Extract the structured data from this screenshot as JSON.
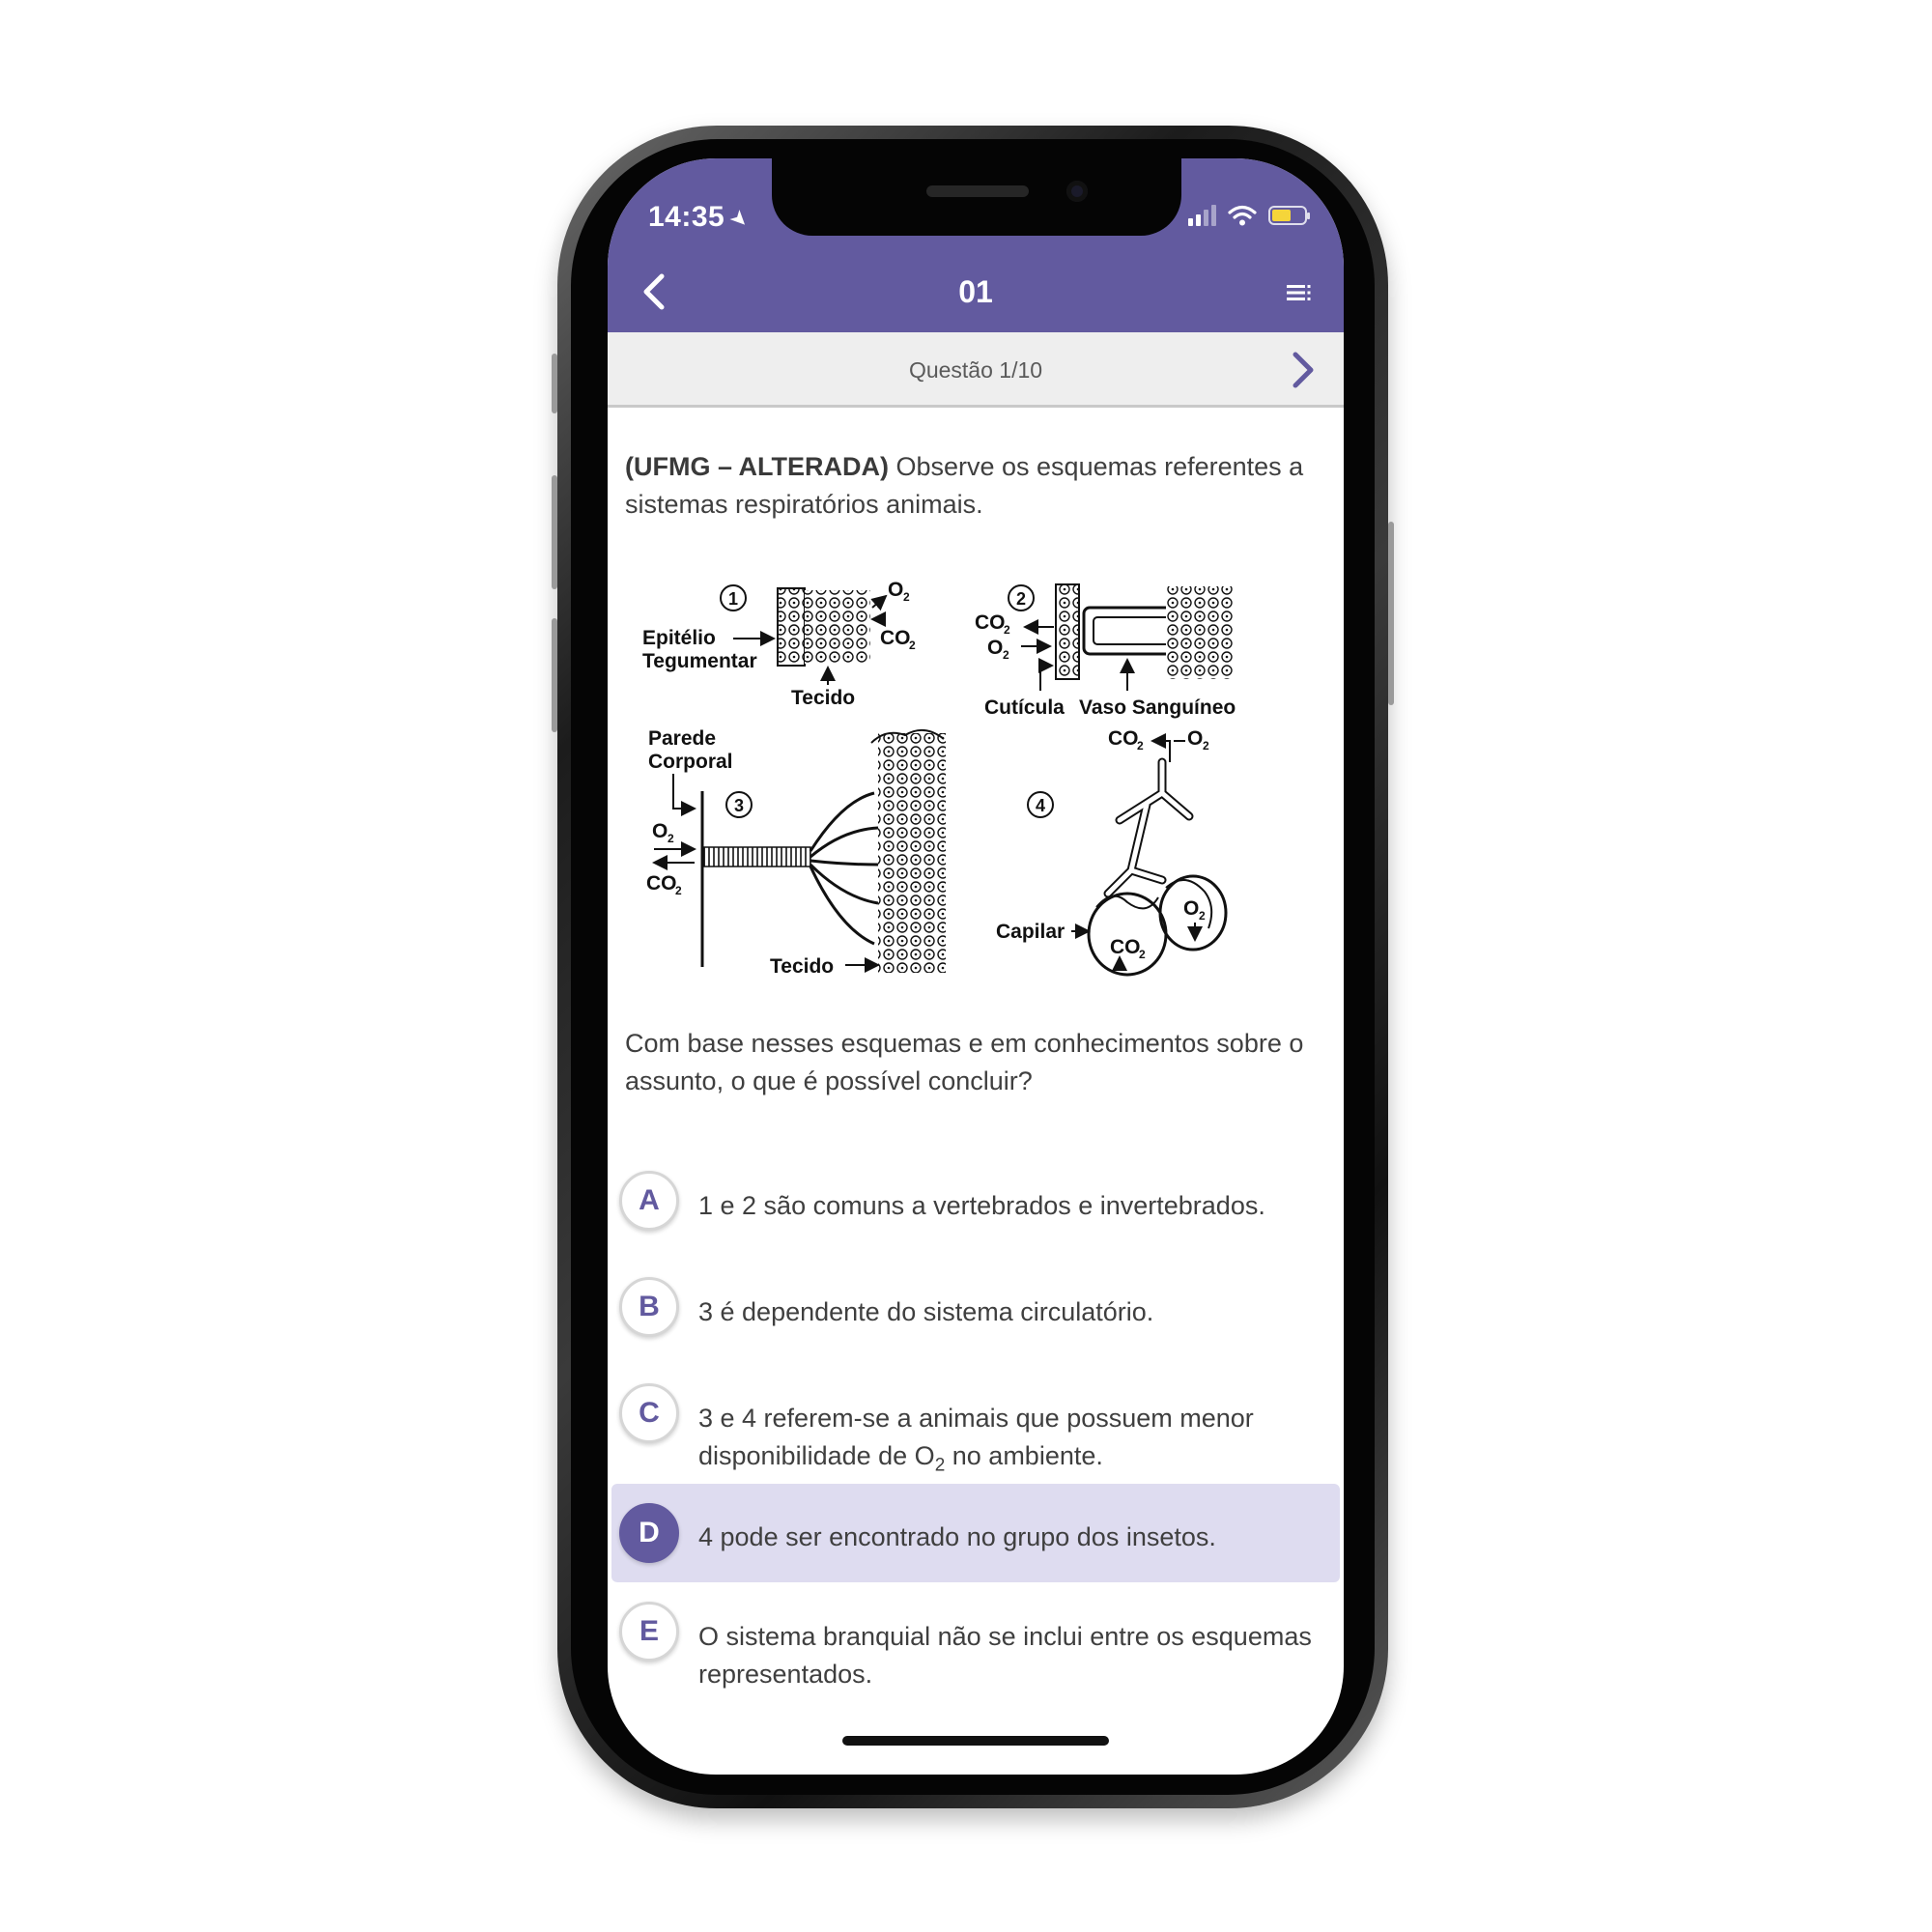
{
  "status_bar": {
    "time": "14:35",
    "location_icon": "location-arrow-icon",
    "battery_color": "#f5d53a"
  },
  "nav": {
    "title": "01",
    "back_icon": "chevron-left-icon",
    "menu_icon": "list-menu-icon",
    "bar_color": "#625a9f"
  },
  "question_bar": {
    "label": "Questão 1/10",
    "next_icon": "chevron-right-icon"
  },
  "question": {
    "source": "(UFMG – ALTERADA)",
    "intro": " Observe os esquemas referentes a sistemas respiratórios animais.",
    "prompt": "Com base nesses esquemas e em conhecimentos sobre o assunto, o que é possível concluir?"
  },
  "figure": {
    "labels": {
      "n1": "1",
      "n2": "2",
      "n3": "3",
      "n4": "4",
      "epitelio": "Epitélio",
      "tegumentar": "Tegumentar",
      "tecido1": "Tecido",
      "tecido2": "Tecido",
      "cuticula": "Cutícula",
      "vaso": "Vaso Sanguíneo",
      "parede": "Parede",
      "corporal": "Corporal",
      "capilar": "Capilar",
      "o2": "O",
      "co2": "CO",
      "sub2": "2"
    }
  },
  "options": [
    {
      "letter": "A",
      "text": "1 e 2 são comuns a vertebrados e invertebrados.",
      "selected": false
    },
    {
      "letter": "B",
      "text": "3 é dependente do sistema circulatório.",
      "selected": false
    },
    {
      "letter": "C",
      "text_before": "3 e 4 referem-se a animais que possuem menor disponibilidade de O",
      "sub": "2",
      "text_after": " no ambiente.",
      "selected": false
    },
    {
      "letter": "D",
      "text": "4 pode ser encontrado no grupo dos insetos.",
      "selected": true
    },
    {
      "letter": "E",
      "text": "O sistema branquial não se inclui entre os esquemas representados.",
      "selected": false
    }
  ]
}
